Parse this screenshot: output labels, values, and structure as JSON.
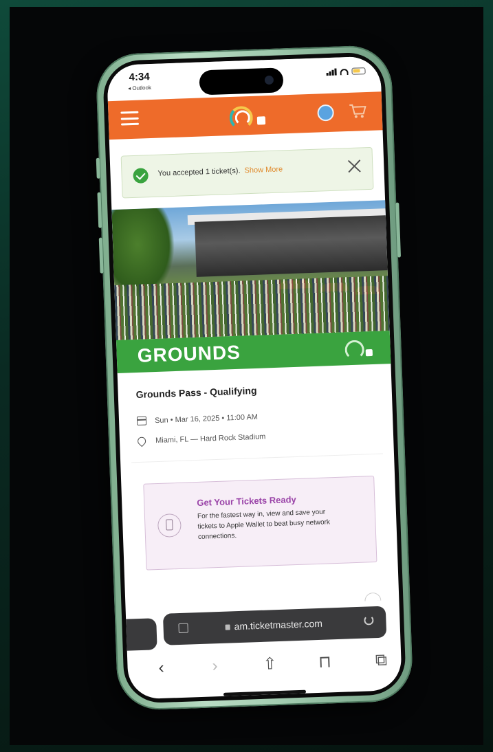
{
  "status_bar": {
    "time": "4:34",
    "back_app": "◂ Outlook"
  },
  "notification": {
    "message": "You accepted 1 ticket(s).",
    "action": "Show More"
  },
  "hero": {
    "category": "GROUNDS"
  },
  "event": {
    "title": "Grounds Pass - Qualifying",
    "datetime": "Sun • Mar 16, 2025 • 11:00 AM",
    "venue": "Miami, FL — Hard Rock Stadium"
  },
  "tickets_ready": {
    "title": "Get Your Tickets Ready",
    "body": "For the fastest way in, view and save your tickets to Apple Wallet to beat busy network connections."
  },
  "browser": {
    "url": "am.ticketmaster.com",
    "toolbar": {
      "back": "‹",
      "forward": "›",
      "share": "⇧",
      "bookmarks": "⊓",
      "tabs": "⧉"
    }
  },
  "colors": {
    "header": "#ee6b2a",
    "grounds_bar": "#3aa33f",
    "ready_title": "#9a44a8",
    "show_more": "#e08a2c"
  }
}
